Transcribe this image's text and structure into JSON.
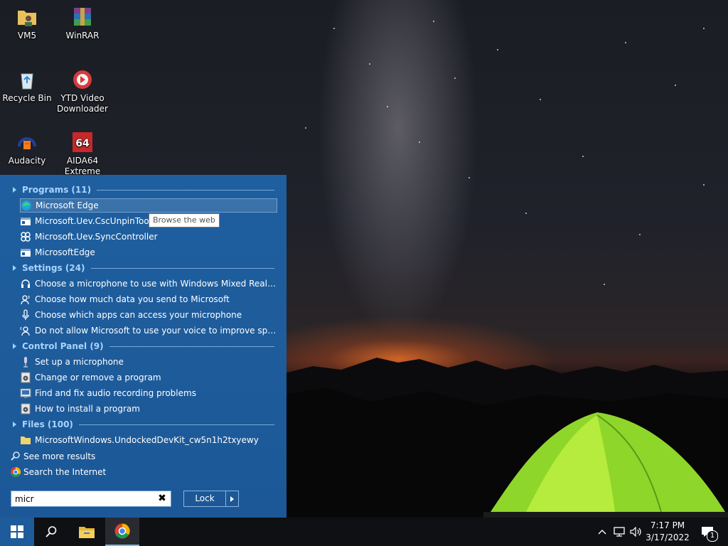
{
  "desktop": {
    "icons": [
      {
        "label": "VM5",
        "icon": "folder-user-icon"
      },
      {
        "label": "WinRAR",
        "icon": "winrar-icon"
      },
      {
        "label": "Recycle Bin",
        "icon": "recycle-bin-icon"
      },
      {
        "label": "YTD Video Downloader",
        "icon": "ytd-icon"
      },
      {
        "label": "Audacity",
        "icon": "audacity-icon"
      },
      {
        "label": "AIDA64 Extreme",
        "icon": "aida64-icon"
      }
    ]
  },
  "start_panel": {
    "groups": {
      "programs": {
        "label": "Programs (11)"
      },
      "settings": {
        "label": "Settings (24)"
      },
      "control_panel": {
        "label": "Control Panel (9)"
      },
      "files": {
        "label": "Files (100)"
      }
    },
    "programs": [
      {
        "label": "Microsoft Edge",
        "icon": "edge-icon"
      },
      {
        "label": "Microsoft.Uev.CscUnpinTool",
        "icon": "app-window-icon"
      },
      {
        "label": "Microsoft.Uev.SyncController",
        "icon": "sync-controller-icon"
      },
      {
        "label": "MicrosoftEdge",
        "icon": "app-window-icon"
      }
    ],
    "settings": [
      {
        "label": "Choose a microphone to use with Windows Mixed Reality",
        "icon": "headset-icon"
      },
      {
        "label": "Choose how much data you send to Microsoft",
        "icon": "person-speech-icon"
      },
      {
        "label": "Choose which apps can access your microphone",
        "icon": "microphone-icon"
      },
      {
        "label": "Do not allow Microsoft to use your voice to improve speech se...",
        "icon": "person-speech-icon"
      }
    ],
    "control_panel": [
      {
        "label": "Set up a microphone",
        "icon": "microphone-icon"
      },
      {
        "label": "Change or remove a program",
        "icon": "programs-icon"
      },
      {
        "label": "Find and fix audio recording problems",
        "icon": "troubleshoot-icon"
      },
      {
        "label": "How to install a program",
        "icon": "programs-icon"
      }
    ],
    "files": [
      {
        "label": "MicrosoftWindows.UndockedDevKit_cw5n1h2txyewy",
        "icon": "folder-icon"
      }
    ],
    "see_more": "See more results",
    "search_internet": "Search the Internet",
    "tooltip": "Browse the web",
    "search": {
      "value": "micr",
      "clear_symbol": "✖"
    },
    "lock_label": "Lock"
  },
  "taskbar": {
    "time": "7:17 PM",
    "date": "3/17/2022",
    "notification_count": "1"
  },
  "colors": {
    "panel": "#1e5b9b",
    "group_header": "#a8d4ff",
    "taskbar": "#0f1014"
  }
}
